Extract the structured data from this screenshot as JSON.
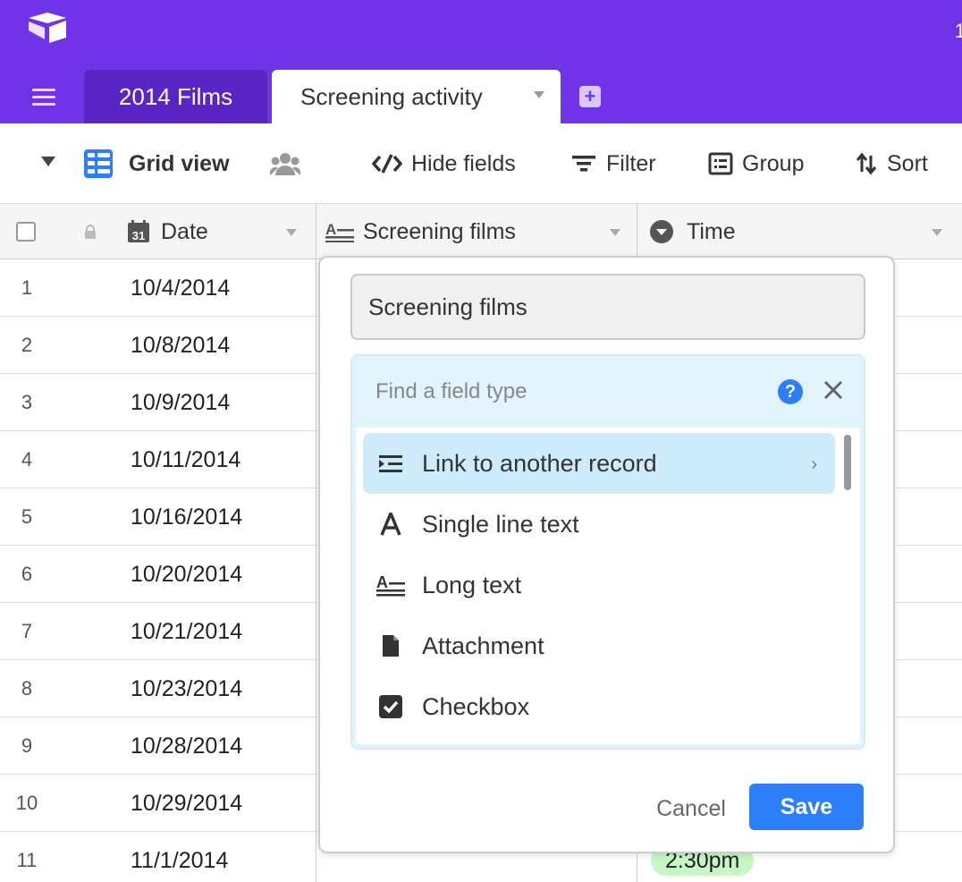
{
  "header": {
    "tabs": [
      {
        "label": "2014 Films"
      },
      {
        "label": "Screening activity"
      }
    ],
    "top_right_glyph": "1"
  },
  "toolbar": {
    "view_name": "Grid view",
    "hide_fields": "Hide fields",
    "filter": "Filter",
    "group": "Group",
    "sort": "Sort"
  },
  "columns": {
    "date": "Date",
    "screening_films": "Screening films",
    "time": "Time"
  },
  "rows": [
    {
      "num": "1",
      "date": "10/4/2014"
    },
    {
      "num": "2",
      "date": "10/8/2014"
    },
    {
      "num": "3",
      "date": "10/9/2014"
    },
    {
      "num": "4",
      "date": "10/11/2014"
    },
    {
      "num": "5",
      "date": "10/16/2014"
    },
    {
      "num": "6",
      "date": "10/20/2014"
    },
    {
      "num": "7",
      "date": "10/21/2014"
    },
    {
      "num": "8",
      "date": "10/23/2014"
    },
    {
      "num": "9",
      "date": "10/28/2014"
    },
    {
      "num": "10",
      "date": "10/29/2014"
    },
    {
      "num": "11",
      "date": "11/1/2014",
      "time": "2:30pm"
    }
  ],
  "field_editor": {
    "field_name": "Screening films",
    "search_placeholder": "Find a field type",
    "help": "?",
    "types": [
      {
        "label": "Link to another record",
        "icon": "link-record-icon",
        "active": true
      },
      {
        "label": "Single line text",
        "icon": "single-line-text-icon"
      },
      {
        "label": "Long text",
        "icon": "long-text-icon"
      },
      {
        "label": "Attachment",
        "icon": "attachment-icon"
      },
      {
        "label": "Checkbox",
        "icon": "checkbox-icon"
      }
    ],
    "cancel": "Cancel",
    "save": "Save"
  },
  "colors": {
    "brand_purple": "#7033E8",
    "accent_blue": "#2D7FF9",
    "time_pill_green": "#C8F7C5"
  }
}
